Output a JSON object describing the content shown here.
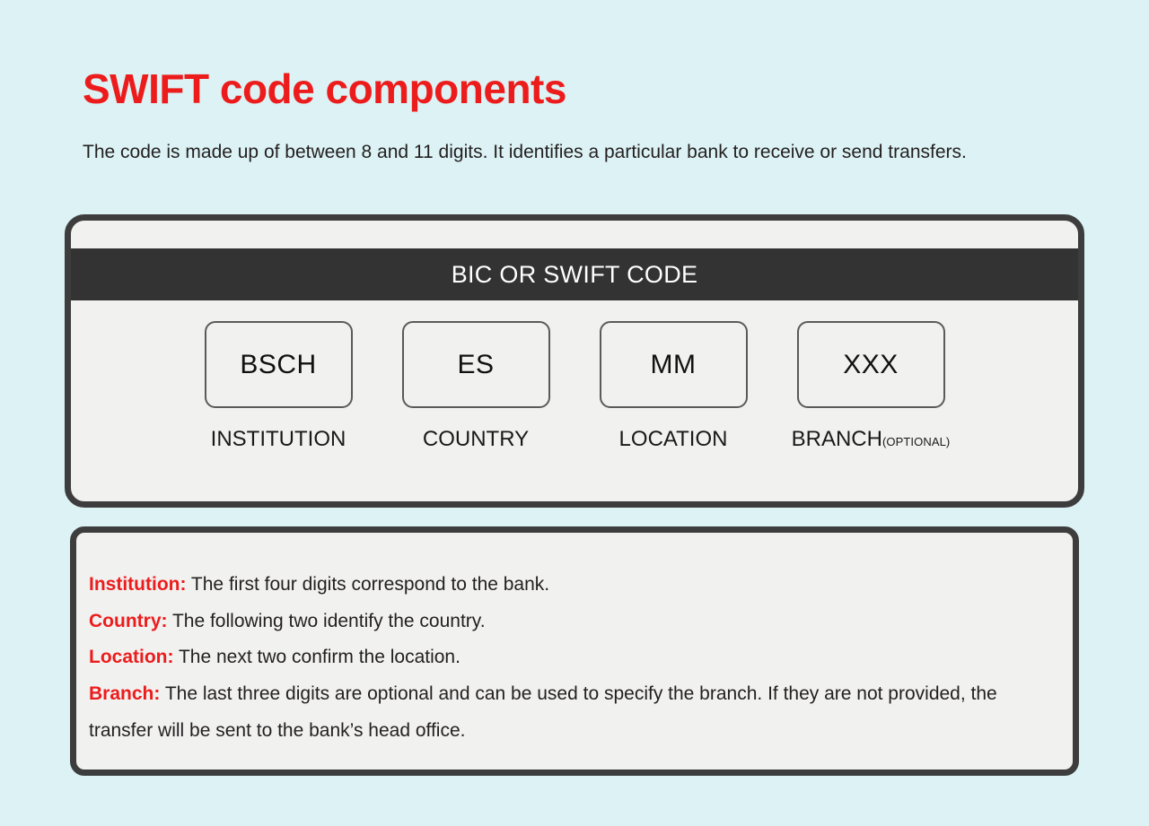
{
  "header": {
    "title": "SWIFT code components",
    "subtitle": "The code is made up of between 8 and 11 digits. It identifies a particular bank to receive or send transfers."
  },
  "code_card": {
    "header_label": "BIC OR SWIFT CODE",
    "segments": [
      {
        "code": "BSCH",
        "label": "INSTITUTION",
        "label_suffix": ""
      },
      {
        "code": "ES",
        "label": "COUNTRY",
        "label_suffix": ""
      },
      {
        "code": "MM",
        "label": "LOCATION",
        "label_suffix": ""
      },
      {
        "code": "XXX",
        "label": "BRANCH",
        "label_suffix": "(OPTIONAL)"
      }
    ]
  },
  "descriptions": [
    {
      "term": "Institution:",
      "text": " The first four digits correspond to the bank."
    },
    {
      "term": "Country:",
      "text": " The following two identify the country."
    },
    {
      "term": "Location:",
      "text": " The next two confirm the location."
    },
    {
      "term": "Branch:",
      "text": " The last three digits are optional and can be used to specify the branch. If they are not provided, the transfer will be sent to the bank’s head office."
    }
  ],
  "colors": {
    "background": "#dcf2f4",
    "accent_red": "#ed1c1c",
    "card_border": "#3d3d3d",
    "card_fill": "#f1f1f0",
    "header_bar": "#333333",
    "body_text": "#231f20"
  }
}
